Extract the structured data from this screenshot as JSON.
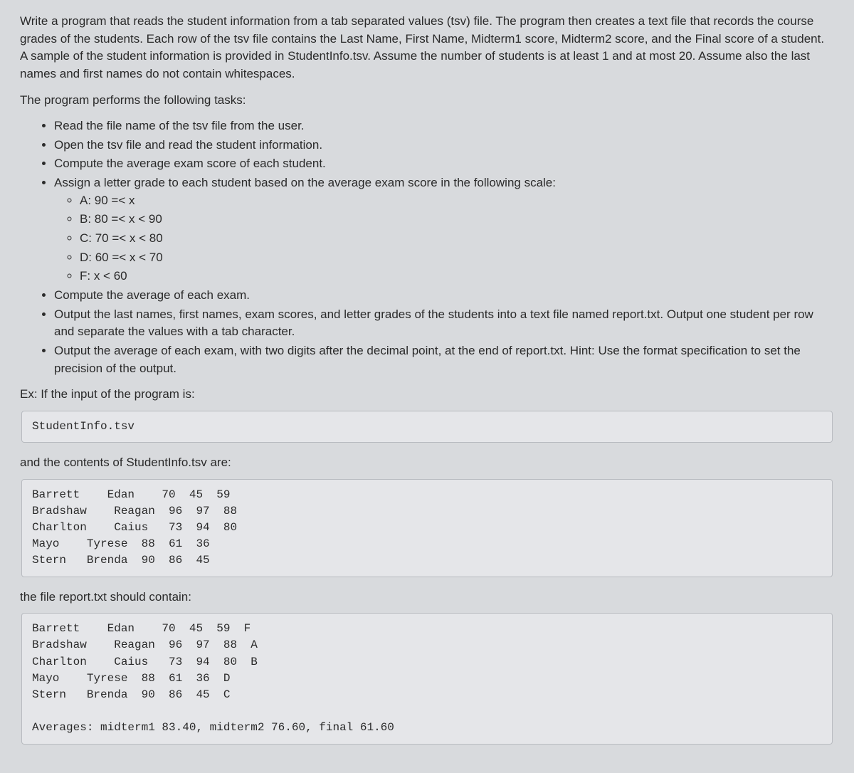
{
  "intro": "Write a program that reads the student information from a tab separated values (tsv) file. The program then creates a text file that records the course grades of the students. Each row of the tsv file contains the Last Name, First Name, Midterm1 score, Midterm2 score, and the Final score of a student. A sample of the student information is provided in StudentInfo.tsv. Assume the number of students is at least 1 and at most 20. Assume also the last names and first names do not contain whitespaces.",
  "tasks_intro": "The program performs the following tasks:",
  "tasks": {
    "item0": "Read the file name of the tsv file from the user.",
    "item1": "Open the tsv file and read the student information.",
    "item2": "Compute the average exam score of each student.",
    "item3": "Assign a letter grade to each student based on the average exam score in the following scale:",
    "grades": {
      "g0": "A: 90 =< x",
      "g1": "B: 80 =< x < 90",
      "g2": "C: 70 =< x < 80",
      "g3": "D: 60 =< x < 70",
      "g4": "F: x < 60"
    },
    "item4": "Compute the average of each exam.",
    "item5": "Output the last names, first names, exam scores, and letter grades of the students into a text file named report.txt. Output one student per row and separate the values with a tab character.",
    "item6": "Output the average of each exam, with two digits after the decimal point, at the end of report.txt. Hint: Use the format specification to set the precision of the output."
  },
  "ex_label": "Ex: If the input of the program is:",
  "code1": "StudentInfo.tsv",
  "contents_label": "and the contents of StudentInfo.tsv are:",
  "code2": "Barrett    Edan    70  45  59\nBradshaw    Reagan  96  97  88\nCharlton    Caius   73  94  80\nMayo    Tyrese  88  61  36\nStern   Brenda  90  86  45",
  "report_label": "the file report.txt should contain:",
  "code3": "Barrett    Edan    70  45  59  F\nBradshaw    Reagan  96  97  88  A\nCharlton    Caius   73  94  80  B\nMayo    Tyrese  88  61  36  D\nStern   Brenda  90  86  45  C\n\nAverages: midterm1 83.40, midterm2 76.60, final 61.60"
}
